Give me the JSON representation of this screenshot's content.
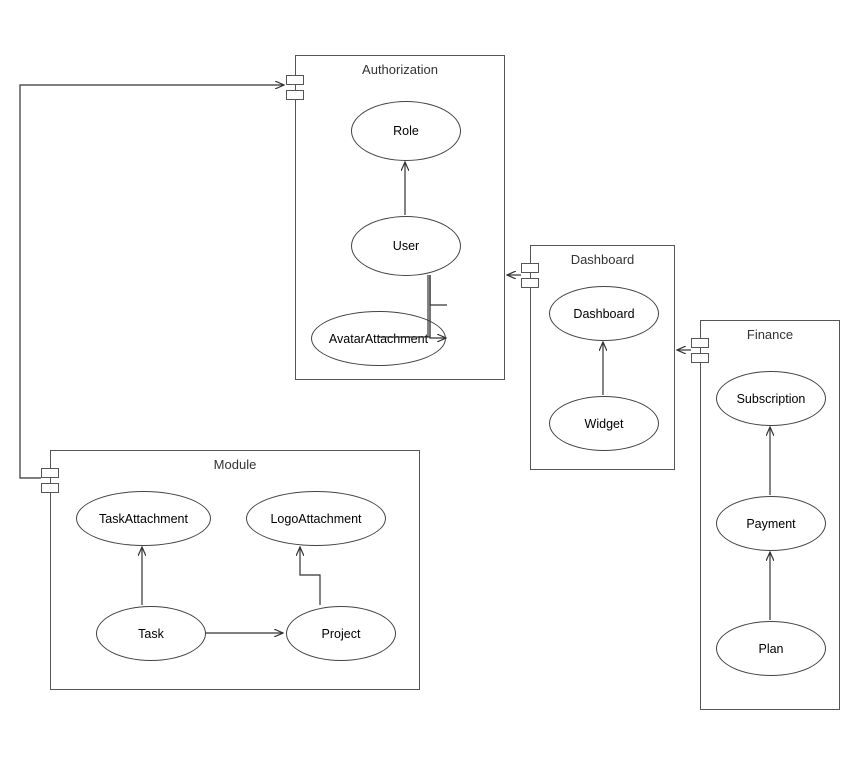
{
  "modules": {
    "authorization": {
      "title": "Authorization",
      "nodes": {
        "role": "Role",
        "user": "User",
        "avatarAttachment": "AvatarAttachment"
      }
    },
    "dashboard": {
      "title": "Dashboard",
      "nodes": {
        "dashboard": "Dashboard",
        "widget": "Widget"
      }
    },
    "finance": {
      "title": "Finance",
      "nodes": {
        "subscription": "Subscription",
        "payment": "Payment",
        "plan": "Plan"
      }
    },
    "module": {
      "title": "Module",
      "nodes": {
        "taskAttachment": "TaskAttachment",
        "logoAttachment": "LogoAttachment",
        "task": "Task",
        "project": "Project"
      }
    }
  },
  "chart_data": {
    "type": "diagram",
    "description": "UML-style package/class dependency diagram with four packages and internal class ellipses connected by directed arrows.",
    "packages": [
      {
        "name": "Authorization",
        "classes": [
          "Role",
          "User",
          "AvatarAttachment"
        ],
        "internal_edges": [
          {
            "from": "User",
            "to": "Role"
          },
          {
            "from": "User",
            "to": "AvatarAttachment"
          }
        ]
      },
      {
        "name": "Dashboard",
        "classes": [
          "Dashboard",
          "Widget"
        ],
        "internal_edges": [
          {
            "from": "Widget",
            "to": "Dashboard"
          }
        ]
      },
      {
        "name": "Finance",
        "classes": [
          "Subscription",
          "Payment",
          "Plan"
        ],
        "internal_edges": [
          {
            "from": "Plan",
            "to": "Payment"
          },
          {
            "from": "Payment",
            "to": "Subscription"
          }
        ]
      },
      {
        "name": "Module",
        "classes": [
          "TaskAttachment",
          "LogoAttachment",
          "Task",
          "Project"
        ],
        "internal_edges": [
          {
            "from": "Task",
            "to": "TaskAttachment"
          },
          {
            "from": "Task",
            "to": "Project"
          },
          {
            "from": "Project",
            "to": "LogoAttachment"
          }
        ]
      }
    ],
    "package_edges": [
      {
        "from": "Module",
        "to": "Authorization"
      },
      {
        "from": "Dashboard",
        "to": "Authorization"
      },
      {
        "from": "Finance",
        "to": "Dashboard"
      }
    ]
  }
}
